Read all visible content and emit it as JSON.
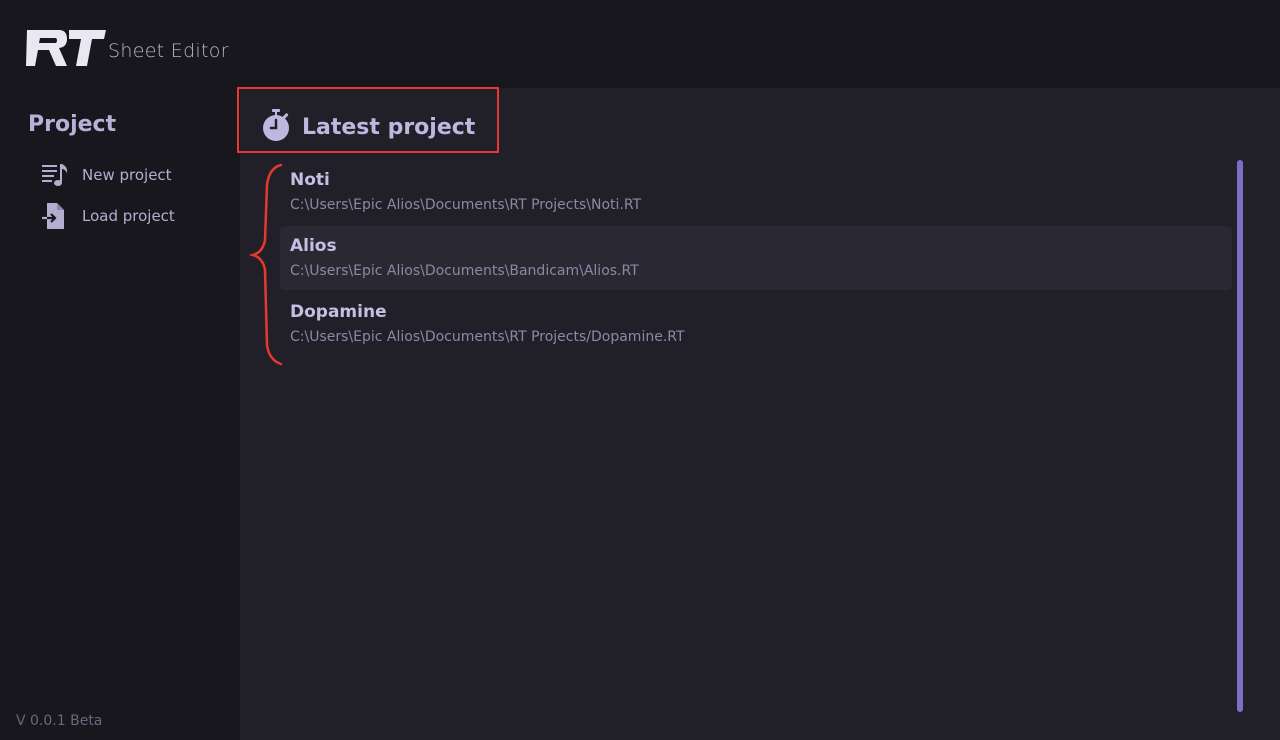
{
  "header": {
    "logo_text": "RT",
    "app_title": "Sheet Editor"
  },
  "sidebar": {
    "heading": "Project",
    "items": [
      {
        "label": "New project",
        "icon": "music-list-icon"
      },
      {
        "label": "Load project",
        "icon": "file-import-icon"
      }
    ],
    "version": "V 0.0.1 Beta"
  },
  "main": {
    "section_title": "Latest project",
    "section_icon": "stopwatch-icon",
    "projects": [
      {
        "name": "Noti",
        "path": "C:\\Users\\Epic Alios\\Documents\\RT Projects\\Noti.RT"
      },
      {
        "name": "Alios",
        "path": "C:\\Users\\Epic Alios\\Documents\\Bandicam\\Alios.RT"
      },
      {
        "name": "Dopamine",
        "path": "C:\\Users\\Epic Alios\\Documents\\RT Projects/Dopamine.RT"
      }
    ]
  },
  "colors": {
    "accent": "#7b6fc4",
    "annotation": "#e3392f",
    "background": "#18171d",
    "panel": "#212029"
  }
}
